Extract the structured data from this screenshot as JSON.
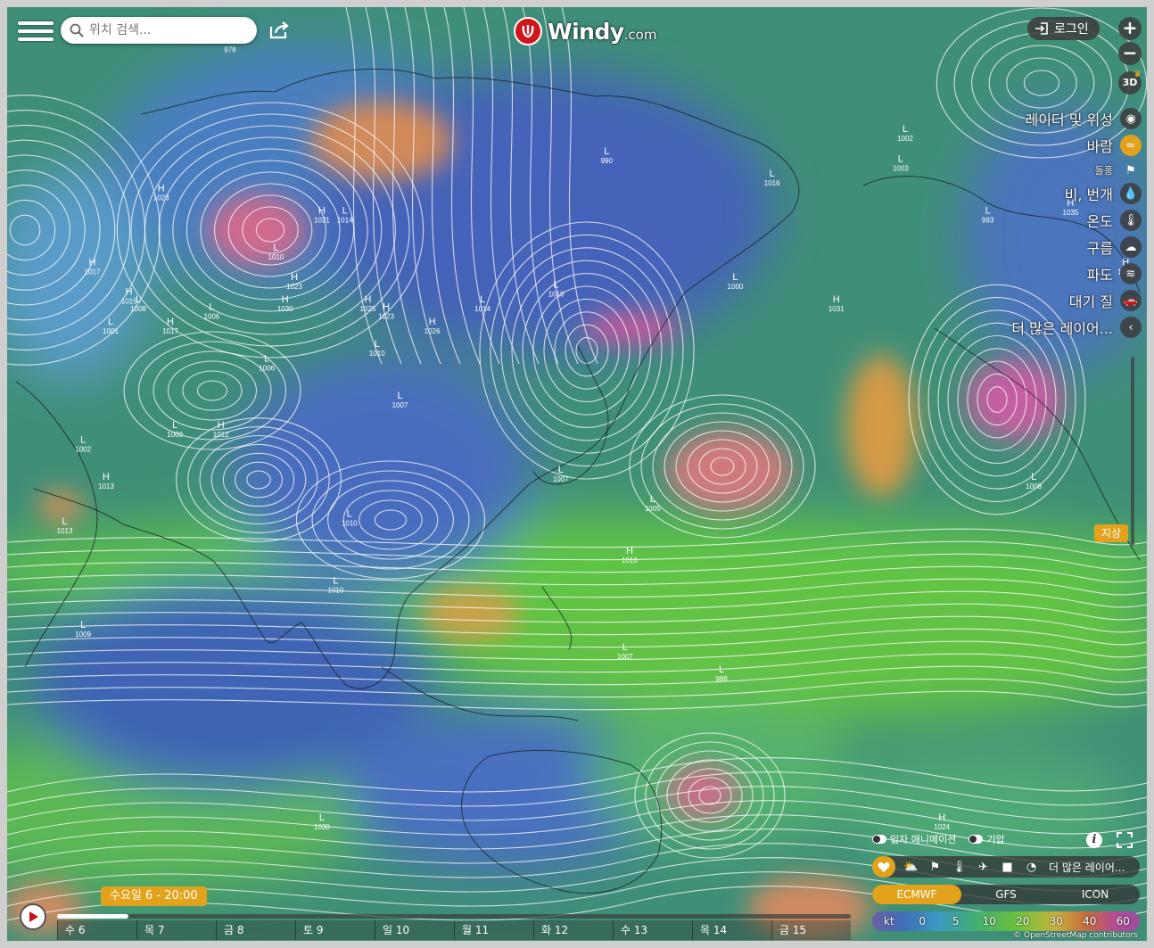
{
  "header": {
    "search_placeholder": "위치 검색...",
    "brand_name": "Windy",
    "brand_domain": ".com",
    "login_label": "로그인",
    "zoom_in": "+",
    "zoom_out": "−",
    "mode_3d": "3D"
  },
  "layers": [
    {
      "label": "레이더 및 위성",
      "icon": "radar-satellite-icon",
      "glyph": "◉",
      "active": false,
      "small": false
    },
    {
      "label": "바람",
      "icon": "wind-icon",
      "glyph": "≈",
      "active": true,
      "small": false
    },
    {
      "label": "돌풍",
      "icon": "gust-flag-icon",
      "glyph": "⚑",
      "active": false,
      "small": true
    },
    {
      "label": "비, 번개",
      "icon": "rain-drop-icon",
      "glyph": "💧",
      "active": false,
      "small": false
    },
    {
      "label": "온도",
      "icon": "thermometer-icon",
      "glyph": "🌡",
      "active": false,
      "small": false
    },
    {
      "label": "구름",
      "icon": "cloud-icon",
      "glyph": "☁",
      "active": false,
      "small": false
    },
    {
      "label": "파도",
      "icon": "waves-icon",
      "glyph": "≋",
      "active": false,
      "small": false
    },
    {
      "label": "대기 질",
      "icon": "car-icon",
      "glyph": "🚗",
      "active": false,
      "small": false
    },
    {
      "label": "더 많은 레이어...",
      "icon": "chevron-left-icon",
      "glyph": "‹",
      "active": false,
      "small": false
    }
  ],
  "altitude": {
    "label": "지상"
  },
  "toggles": {
    "particles": "입자 애니메이션",
    "pressure": "기압"
  },
  "quick_bar": {
    "more": "더 많은 레이어..."
  },
  "models": {
    "items": [
      "ECMWF",
      "GFS",
      "ICON"
    ],
    "selected": "ECMWF"
  },
  "scale": {
    "unit": "kt",
    "values": [
      "0",
      "5",
      "10",
      "20",
      "30",
      "40",
      "60"
    ]
  },
  "timeline": {
    "current": "수요일 6 - 20:00",
    "progress": 0.09,
    "days": [
      "수 6",
      "목 7",
      "금 8",
      "토 9",
      "일 10",
      "월 11",
      "화 12",
      "수 13",
      "목 14",
      "금 15"
    ]
  },
  "attribution": "© OpenStreetMap contributors",
  "pressure_systems": [
    {
      "type": "L",
      "value": "978",
      "lon": 30,
      "lat": 65
    },
    {
      "type": "H",
      "value": "1023",
      "lon": 15,
      "lat": 45
    },
    {
      "type": "H",
      "value": "1021",
      "lon": 50,
      "lat": 42
    },
    {
      "type": "L",
      "value": "1014",
      "lon": 55,
      "lat": 42
    },
    {
      "type": "L",
      "value": "1010",
      "lon": 40,
      "lat": 37
    },
    {
      "type": "H",
      "value": "1023",
      "lon": 44,
      "lat": 33
    },
    {
      "type": "H",
      "value": "1030",
      "lon": 42,
      "lat": 30
    },
    {
      "type": "H",
      "value": "1025",
      "lon": 60,
      "lat": 30
    },
    {
      "type": "H",
      "value": "1023",
      "lon": 64,
      "lat": 29
    },
    {
      "type": "H",
      "value": "1026",
      "lon": 74,
      "lat": 27
    },
    {
      "type": "L",
      "value": "1010",
      "lon": 62,
      "lat": 24
    },
    {
      "type": "L",
      "value": "1006",
      "lon": 38,
      "lat": 22
    },
    {
      "type": "L",
      "value": "1007",
      "lon": 67,
      "lat": 17
    },
    {
      "type": "L",
      "value": "1014",
      "lon": 85,
      "lat": 30
    },
    {
      "type": "L",
      "value": "1018",
      "lon": 101,
      "lat": 32
    },
    {
      "type": "L",
      "value": "990",
      "lon": 112,
      "lat": 50
    },
    {
      "type": "H",
      "value": "1017",
      "lon": 0,
      "lat": 35
    },
    {
      "type": "H",
      "value": "1015",
      "lon": 8,
      "lat": 31
    },
    {
      "type": "L",
      "value": "1008",
      "lon": 10,
      "lat": 30
    },
    {
      "type": "L",
      "value": "1001",
      "lon": 4,
      "lat": 27
    },
    {
      "type": "H",
      "value": "1017",
      "lon": 17,
      "lat": 27
    },
    {
      "type": "L",
      "value": "1006",
      "lon": 26,
      "lat": 29
    },
    {
      "type": "L",
      "value": "1009",
      "lon": 18,
      "lat": 13
    },
    {
      "type": "H",
      "value": "1012",
      "lon": 28,
      "lat": 13
    },
    {
      "type": "L",
      "value": "1002",
      "lon": -2,
      "lat": 11
    },
    {
      "type": "H",
      "value": "1013",
      "lon": 3,
      "lat": 6
    },
    {
      "type": "L",
      "value": "1013",
      "lon": -6,
      "lat": 0
    },
    {
      "type": "L",
      "value": "1010",
      "lon": 56,
      "lat": 1
    },
    {
      "type": "L",
      "value": "1010",
      "lon": 53,
      "lat": -8
    },
    {
      "type": "L",
      "value": "1009",
      "lon": -2,
      "lat": -14
    },
    {
      "type": "L",
      "value": "1007",
      "lon": 102,
      "lat": 7
    },
    {
      "type": "L",
      "value": "1005",
      "lon": 122,
      "lat": 3
    },
    {
      "type": "H",
      "value": "1016",
      "lon": 117,
      "lat": -4
    },
    {
      "type": "L",
      "value": "1007",
      "lon": 116,
      "lat": -17
    },
    {
      "type": "L",
      "value": "988",
      "lon": 137,
      "lat": -20
    },
    {
      "type": "L",
      "value": "1000",
      "lon": 140,
      "lat": 33
    },
    {
      "type": "H",
      "value": "1031",
      "lon": 162,
      "lat": 30
    },
    {
      "type": "L",
      "value": "1016",
      "lon": 148,
      "lat": 47
    },
    {
      "type": "L",
      "value": "1002",
      "lon": 177,
      "lat": 53
    },
    {
      "type": "L",
      "value": "1003",
      "lon": 176,
      "lat": 49
    },
    {
      "type": "L",
      "value": "993",
      "lon": 195,
      "lat": 42
    },
    {
      "type": "H",
      "value": "1035",
      "lon": 213,
      "lat": 43
    },
    {
      "type": "H",
      "value": "1037",
      "lon": 225,
      "lat": 35
    },
    {
      "type": "H",
      "value": "1024",
      "lon": 208,
      "lat": 76
    },
    {
      "type": "L",
      "value": "1008",
      "lon": 205,
      "lat": 6
    },
    {
      "type": "H",
      "value": "1024",
      "lon": 185,
      "lat": -40
    },
    {
      "type": "L",
      "value": "1030",
      "lon": 50,
      "lat": -40
    }
  ]
}
